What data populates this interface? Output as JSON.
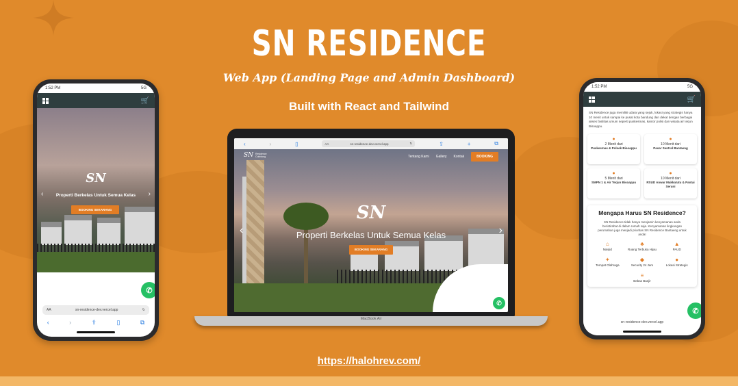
{
  "header": {
    "title": "SN RESIDENCE",
    "subtitle": "Web App (Landing Page and Admin Dashboard)",
    "built_with": "Built with React and Tailwind"
  },
  "footer": {
    "link": "https://halohrev.com/"
  },
  "colors": {
    "background": "#e08a2b",
    "accent": "#e27d25",
    "appbar": "#2f3e3f",
    "whatsapp": "#25c064"
  },
  "left_phone": {
    "time": "1:52 PM",
    "signal": "5G",
    "menu_icon": "grid-icon",
    "cart_icon": "cart-icon",
    "logo": "SN",
    "hero_title": "Properti Berkelas Untuk Semua Kelas",
    "cta": "BOOKING SEKARANG",
    "url_aa": "AA",
    "url": "sn-residence-dev.vercel.app"
  },
  "laptop": {
    "address": "sn-residence-dev.vercel.app",
    "address_prefix": "AA",
    "brand_logo": "SN",
    "brand_name": "Residence Cobblong",
    "nav": [
      "Tentang Kami",
      "Gallery",
      "Kontak"
    ],
    "nav_cta": "BOOKING",
    "hero_logo": "SN",
    "hero_title": "Properti Berkelas Untuk Semua Kelas",
    "cta": "BOOKING SEKARANG",
    "model": "MacBook Air"
  },
  "right_phone": {
    "time": "1:52 PM",
    "signal": "5G",
    "intro": "SN Residence juga memiliki udara yang sejuk, lokasi yang strategis hanya 10 menit untuk sampai ke pusat kota bandung dan dekat dengan berbagai akses fasilitas umum seperti puskesmas, kantor polisi dan wisata air terjun Bisoappu.",
    "locations": [
      {
        "time": "2 Menit dari",
        "place": "Puskesmas & Polsek Bisoappu"
      },
      {
        "time": "10 Menit dari",
        "place": "Pasar Sentral Bantaeng"
      },
      {
        "time": "5 Menit dari",
        "place": "SMPN 1 & Air Terjun Bisoappu"
      },
      {
        "time": "10 Menit dari",
        "place": "RSUD Anwar Makkatutu & Pantai Seruni"
      }
    ],
    "why_title": "Mengapa Harus SN Residence?",
    "why_text": "SN Residence tidak hanya menjamin kenyamanan anda beristirahat di dalam rumah saja. Kenyamanan lingkungan perumahan juga menjadi prioritas SN Residence Bantaeng untuk anda!",
    "features": [
      {
        "icon": "mosque-icon",
        "label": "Masjid"
      },
      {
        "icon": "tree-icon",
        "label": "Ruang Terbuka Hijau"
      },
      {
        "icon": "graduation-icon",
        "label": "PAUD"
      },
      {
        "icon": "fitness-icon",
        "label": "Tempat Olahraga"
      },
      {
        "icon": "shield-icon",
        "label": "Security 24 Jam"
      },
      {
        "icon": "pin-icon",
        "label": "Lokasi Strategis"
      },
      {
        "icon": "flood-icon",
        "label": "Bebas Banjir"
      }
    ],
    "url": "sn-residence-dev.vercel.app"
  }
}
